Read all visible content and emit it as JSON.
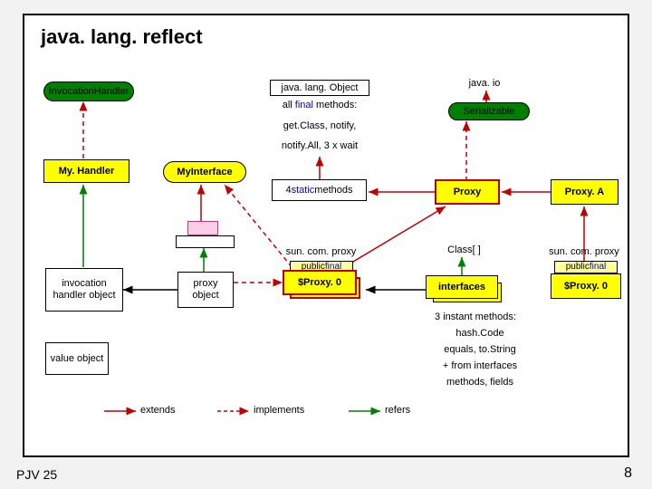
{
  "title": "java. lang. reflect",
  "nodes": {
    "invocation_handler": "InvocationHandler",
    "java_lang_object": "java. lang. Object",
    "all_final_methods": "all final methods:",
    "get_class_notify": "get.Class, notify,",
    "notify_all": "notify.All, 3 x wait",
    "java_io": "java. io",
    "serializable": "Serializable",
    "my_handler": "My. Handler",
    "my_interface": "MyInterface",
    "four_static_methods": "4 static methods",
    "proxy": "Proxy",
    "proxy_a": "Proxy. A",
    "sun_com_proxy_left": "sun. com. proxy",
    "sun_com_proxy_right": "sun. com. proxy",
    "public_final_left": "public final",
    "public_final_right": "public final",
    "dollar_proxy_left": "$Proxy. 0",
    "dollar_proxy_right": "$Proxy. 0",
    "class_arr": "Class[ ]",
    "interfaces": "interfaces",
    "inv_handler_obj": "invocation handler object",
    "proxy_obj": "proxy object",
    "value_obj": "value object",
    "three_instant": "3 instant methods:",
    "hash_code": "hash.Code",
    "equals_tostring": "equals, to.String",
    "from_interfaces": "+ from interfaces",
    "methods_fields": "methods, fields"
  },
  "legend": {
    "extends": "extends",
    "implements": "implements",
    "refers": "refers"
  },
  "footer": {
    "left": "PJV 25",
    "right": "8"
  }
}
